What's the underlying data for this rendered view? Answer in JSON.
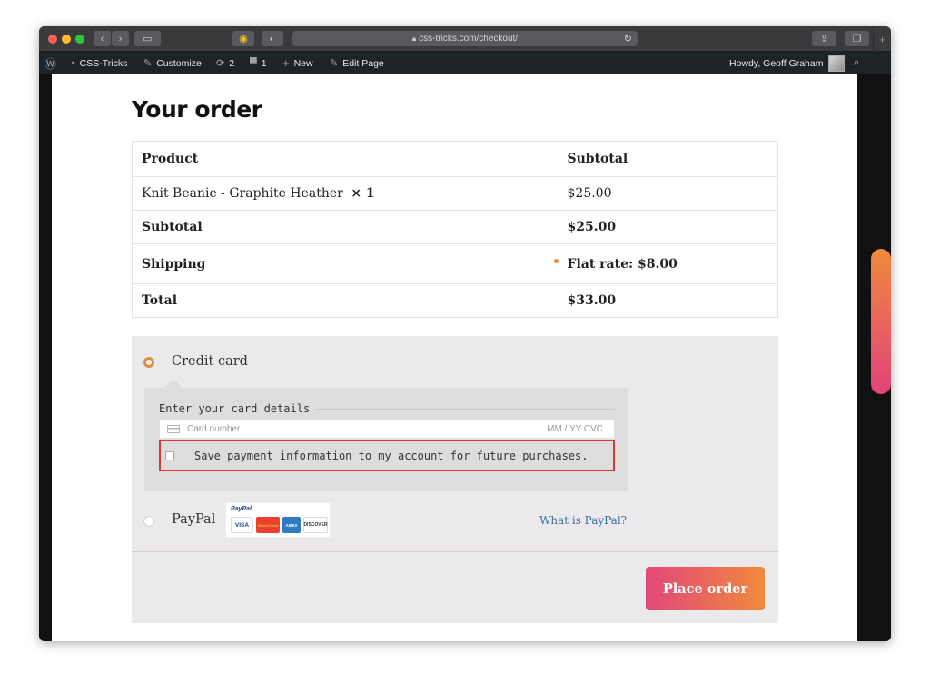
{
  "browser": {
    "url": "css-tricks.com/checkout/",
    "lock_icon": "lock-icon"
  },
  "adminbar": {
    "site_name": "CSS-Tricks",
    "customize": "Customize",
    "updates_count": "2",
    "comments_count": "1",
    "new_label": "New",
    "edit_page": "Edit Page",
    "howdy": "Howdy, Geoff Graham"
  },
  "order": {
    "title": "Your order",
    "headers": {
      "product": "Product",
      "subtotal": "Subtotal"
    },
    "item": {
      "name": "Knit Beanie - Graphite Heather",
      "qty": "× 1",
      "price": "$25.00"
    },
    "subtotal": {
      "label": "Subtotal",
      "value": "$25.00"
    },
    "shipping": {
      "label": "Shipping",
      "value": "Flat rate: $8.00"
    },
    "total": {
      "label": "Total",
      "value": "$33.00"
    }
  },
  "payment": {
    "credit_card_label": "Credit card",
    "card_details_legend": "Enter your card details",
    "card_number_placeholder": "Card number",
    "card_expiry_cvc": "MM / YY  CVC",
    "save_payment_label": "Save payment information to my account for future purchases.",
    "paypal_label": "PayPal",
    "paypal_logo_text": "PayPal",
    "card_brands": [
      "VISA",
      "MasterCard",
      "AMEX",
      "DISCOVER"
    ],
    "what_is_paypal": "What is PayPal?",
    "place_order": "Place order"
  },
  "colors": {
    "accent_orange": "#e38a3e",
    "accent_pink": "#e2477a",
    "highlight_red": "#d63a32",
    "link_blue": "#3b6f9e"
  }
}
